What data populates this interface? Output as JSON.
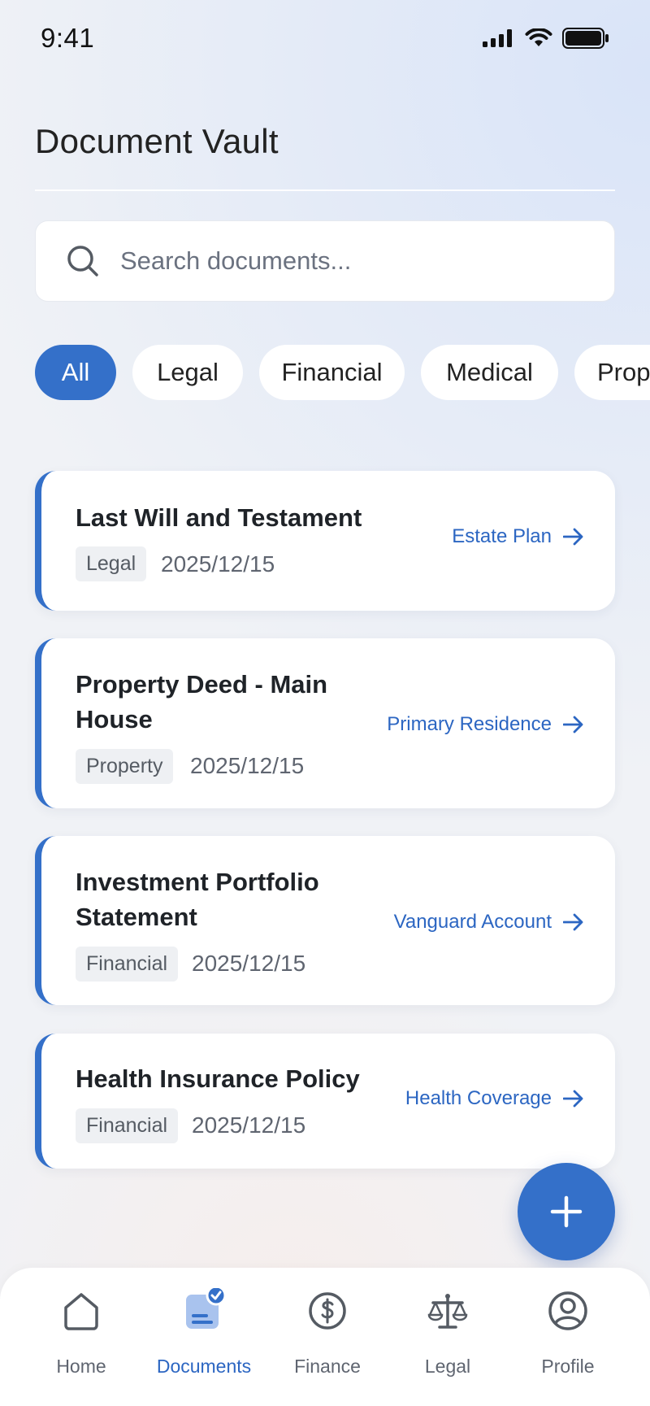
{
  "status_bar": {
    "time": "9:41"
  },
  "header": {
    "title": "Document Vault"
  },
  "search": {
    "placeholder": "Search documents..."
  },
  "filters": [
    {
      "label": "All",
      "active": true
    },
    {
      "label": "Legal",
      "active": false
    },
    {
      "label": "Financial",
      "active": false
    },
    {
      "label": "Medical",
      "active": false
    },
    {
      "label": "Prop",
      "active": false
    }
  ],
  "documents": [
    {
      "title": "Last Will and Testament",
      "tag": "Legal",
      "date": "2025/12/15",
      "link": "Estate Plan"
    },
    {
      "title": "Property Deed - Main House",
      "tag": "Property",
      "date": "2025/12/15",
      "link": "Primary Residence"
    },
    {
      "title": "Investment Portfolio Statement",
      "tag": "Financial",
      "date": "2025/12/15",
      "link": "Vanguard Account"
    },
    {
      "title": "Health Insurance Policy",
      "tag": "Financial",
      "date": "2025/12/15",
      "link": "Health Coverage"
    }
  ],
  "nav": [
    {
      "label": "Home",
      "icon": "home-icon",
      "active": false
    },
    {
      "label": "Documents",
      "icon": "documents-icon",
      "active": true
    },
    {
      "label": "Finance",
      "icon": "dollar-icon",
      "active": false
    },
    {
      "label": "Legal",
      "icon": "scales-icon",
      "active": false
    },
    {
      "label": "Profile",
      "icon": "user-icon",
      "active": false
    }
  ],
  "colors": {
    "accent": "#3470c9",
    "background": "#f0f2f6",
    "link": "#2c66c2"
  }
}
